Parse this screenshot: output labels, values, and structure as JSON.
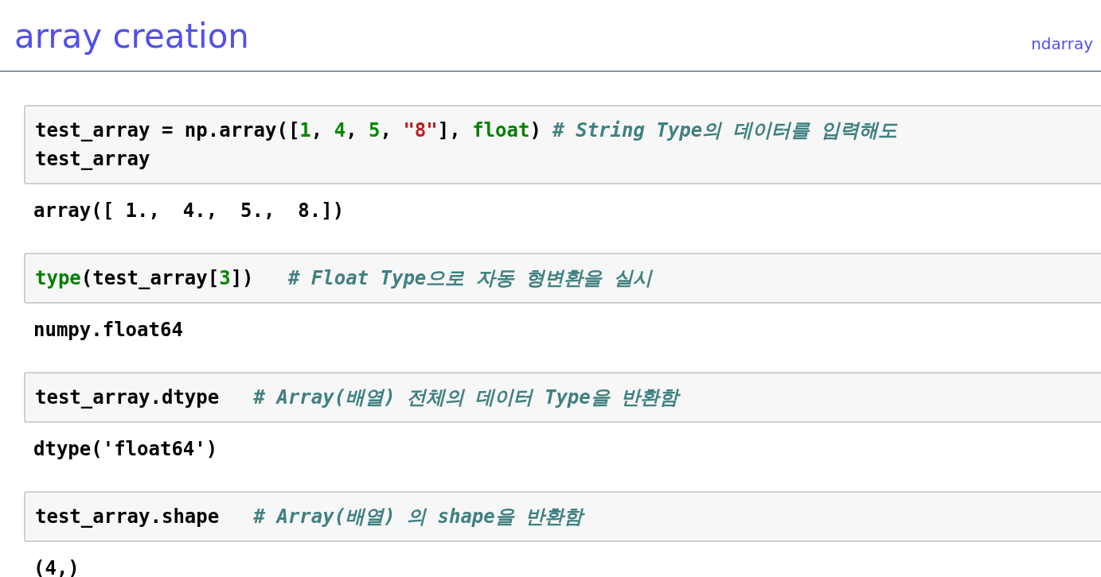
{
  "header": {
    "title": "array creation",
    "link": "ndarray"
  },
  "cells": [
    {
      "input": [
        [
          {
            "kind": "plain",
            "text": "test_array = np.array(["
          },
          {
            "kind": "number",
            "text": "1"
          },
          {
            "kind": "plain",
            "text": ", "
          },
          {
            "kind": "number",
            "text": "4"
          },
          {
            "kind": "plain",
            "text": ", "
          },
          {
            "kind": "number",
            "text": "5"
          },
          {
            "kind": "plain",
            "text": ", "
          },
          {
            "kind": "string",
            "text": "\"8\""
          },
          {
            "kind": "plain",
            "text": "], "
          },
          {
            "kind": "builtin",
            "text": "float"
          },
          {
            "kind": "plain",
            "text": ") "
          },
          {
            "kind": "comment",
            "text": "# String Type의 데이터를 입력해도"
          }
        ],
        [
          {
            "kind": "plain",
            "text": "test_array"
          }
        ]
      ],
      "output": "array([ 1.,  4.,  5.,  8.])"
    },
    {
      "input": [
        [
          {
            "kind": "builtin",
            "text": "type"
          },
          {
            "kind": "plain",
            "text": "(test_array["
          },
          {
            "kind": "number",
            "text": "3"
          },
          {
            "kind": "plain",
            "text": "])   "
          },
          {
            "kind": "comment",
            "text": "# Float Type으로 자동 형변환을 실시"
          }
        ]
      ],
      "output": "numpy.float64"
    },
    {
      "input": [
        [
          {
            "kind": "plain",
            "text": "test_array.dtype   "
          },
          {
            "kind": "comment",
            "text": "# Array(배열) 전체의 데이터 Type을 반환함"
          }
        ]
      ],
      "output": "dtype('float64')"
    },
    {
      "input": [
        [
          {
            "kind": "plain",
            "text": "test_array.shape   "
          },
          {
            "kind": "comment",
            "text": "# Array(배열) 의 shape을 반환함"
          }
        ]
      ],
      "output": "(4,)"
    }
  ]
}
